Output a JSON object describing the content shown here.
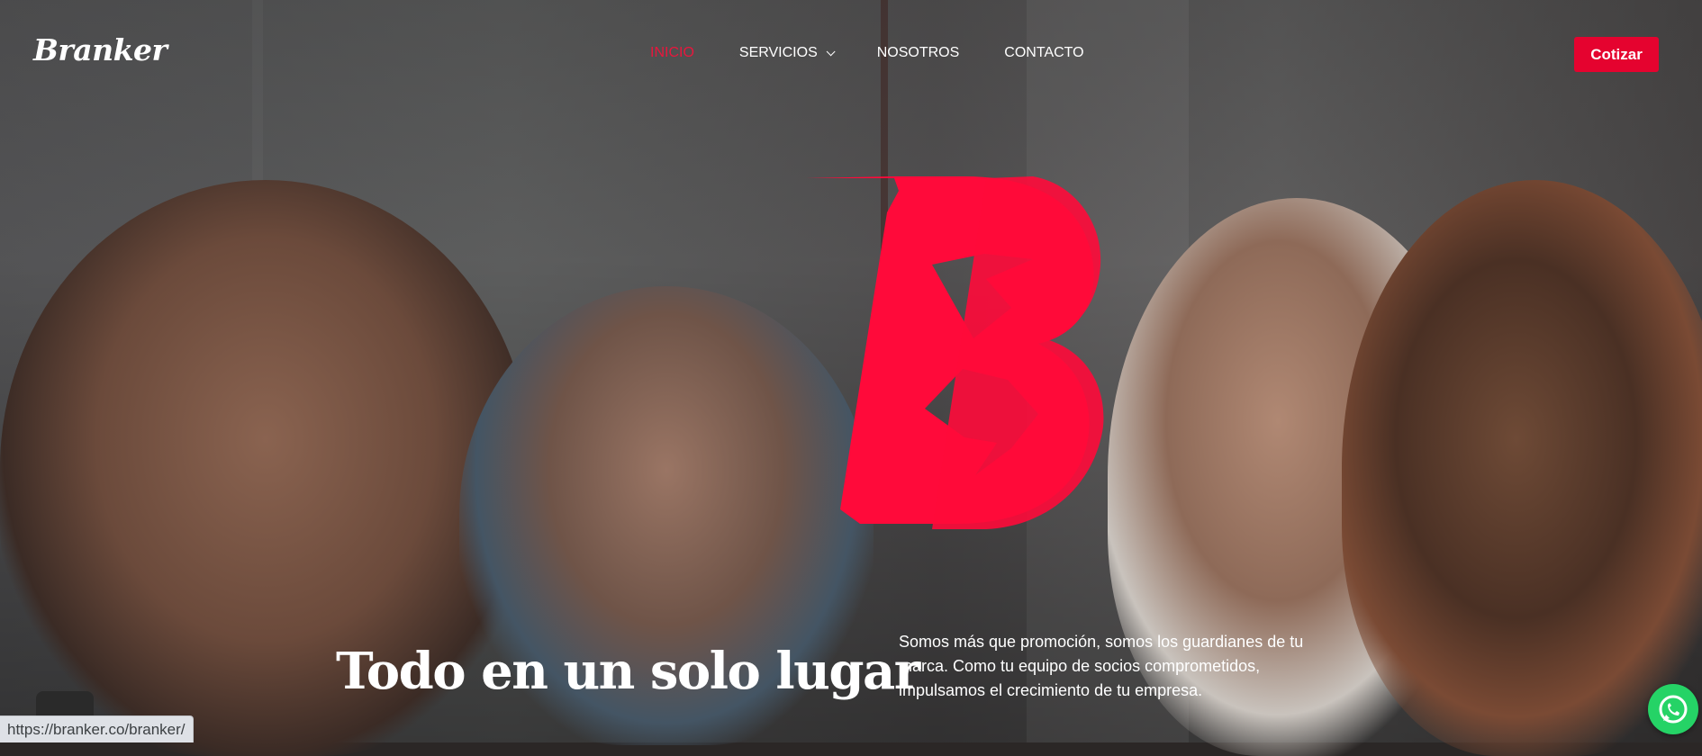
{
  "brand": {
    "logo_text": "Branker",
    "accent_color": "#e5032f"
  },
  "nav": {
    "items": [
      {
        "label": "INICIO",
        "active": true
      },
      {
        "label": "SERVICIOS",
        "has_dropdown": true
      },
      {
        "label": "NOSOTROS"
      },
      {
        "label": "CONTACTO"
      }
    ]
  },
  "header": {
    "cta_label": "Cotizar"
  },
  "hero": {
    "headline": "Todo en un solo lugar",
    "tagline": "Somos más que promoción, somos los guardianes de tu marca. Como tu equipo de socios comprometidos, impulsamos el crecimiento de tu empresa."
  },
  "status_bar": {
    "url": "https://branker.co/branker/"
  },
  "floating": {
    "whatsapp_icon": "whatsapp-icon"
  }
}
